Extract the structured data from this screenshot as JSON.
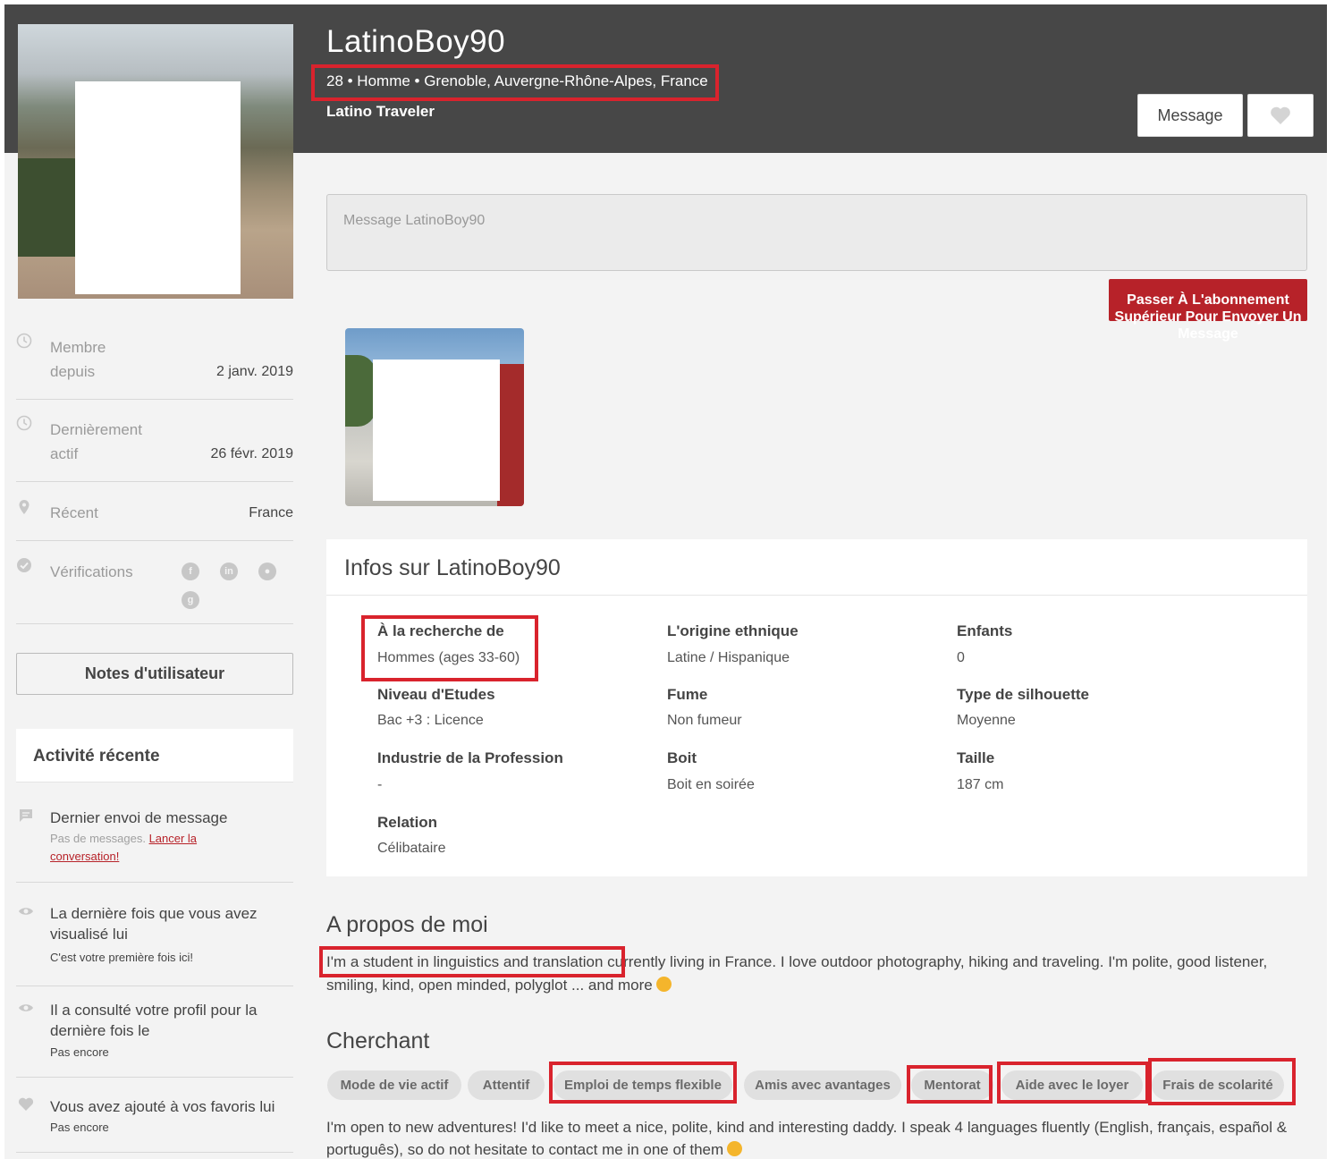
{
  "profile": {
    "username": "LatinoBoy90",
    "meta": "28 • Homme • Grenoble, Auvergne-Rhône-Alpes, France",
    "headline": "Latino Traveler"
  },
  "header_actions": {
    "message_label": "Message",
    "favorite_icon": "heart-icon"
  },
  "sidebar": {
    "rows": [
      {
        "label": "Membre\ndepuis",
        "value": "2 janv. 2019",
        "icon": "clock-icon"
      },
      {
        "label": "Dernièrement\nactif",
        "value": "26 févr. 2019",
        "icon": "clock-icon"
      },
      {
        "label": "Récent",
        "value": "France",
        "icon": "location-pin-icon"
      },
      {
        "label": "Vérifications",
        "icon": "check-circle-icon"
      }
    ],
    "verification_icons": [
      "facebook-icon",
      "linkedin-icon",
      "user-icon",
      "google-plus-icon"
    ],
    "notes_button": "Notes d'utilisateur",
    "activity_title": "Activité récente",
    "activity": [
      {
        "title": "Dernier envoi de message",
        "sub_prefix": "Pas de messages. ",
        "sub_link": "Lancer la conversation!",
        "icon": "chat-icon"
      },
      {
        "title": "La dernière fois que vous avez visualisé lui",
        "sub": "C'est votre première fois ici!",
        "icon": "eye-icon"
      },
      {
        "title": "Il a consulté votre profil pour la dernière fois le",
        "sub": "Pas encore",
        "icon": "eye-icon"
      },
      {
        "title": "Vous avez ajouté à vos favoris lui",
        "sub": "Pas encore",
        "icon": "heart-icon"
      }
    ]
  },
  "message_box": {
    "placeholder": "Message LatinoBoy90"
  },
  "upgrade_button": "Passer À L'abonnement Supérieur Pour Envoyer Un Message",
  "infos": {
    "title": "Infos sur LatinoBoy90",
    "fields": [
      {
        "label": "À la recherche de",
        "value": "Hommes (ages 33-60)"
      },
      {
        "label": "L'origine ethnique",
        "value": "Latine / Hispanique"
      },
      {
        "label": "Enfants",
        "value": "0"
      },
      {
        "label": "Niveau d'Etudes",
        "value": "Bac +3 : Licence"
      },
      {
        "label": "Fume",
        "value": "Non fumeur"
      },
      {
        "label": "Type de silhouette",
        "value": "Moyenne"
      },
      {
        "label": "Industrie de la Profession",
        "value": "-"
      },
      {
        "label": "Boit",
        "value": "Boit en soirée"
      },
      {
        "label": "Taille",
        "value": "187 cm"
      },
      {
        "label": "Relation",
        "value": "Célibataire"
      }
    ]
  },
  "about": {
    "title": "A propos de moi",
    "highlight": "I'm a student in linguistics and translation",
    "rest": " currently living in France. I love outdoor photography, hiking and traveling. I'm polite, good listener, smiling, kind, open minded, polyglot ... and more"
  },
  "seeking": {
    "title": "Cherchant",
    "tags": [
      "Mode de vie actif",
      "Attentif",
      "Emploi de temps flexible",
      "Amis avec avantages",
      "Mentorat",
      "Aide avec le loyer",
      "Frais de scolarité"
    ],
    "text": "I'm open to new adventures! I'd like to meet a nice, polite, kind and interesting daddy. I speak 4 languages fluently (English, français, español & português), so do not hesitate to contact me in one of them"
  },
  "colors": {
    "header_bg": "#474747",
    "accent_red": "#b72229",
    "annotation_red": "#d9232d",
    "page_bg": "#f3f3f3"
  }
}
